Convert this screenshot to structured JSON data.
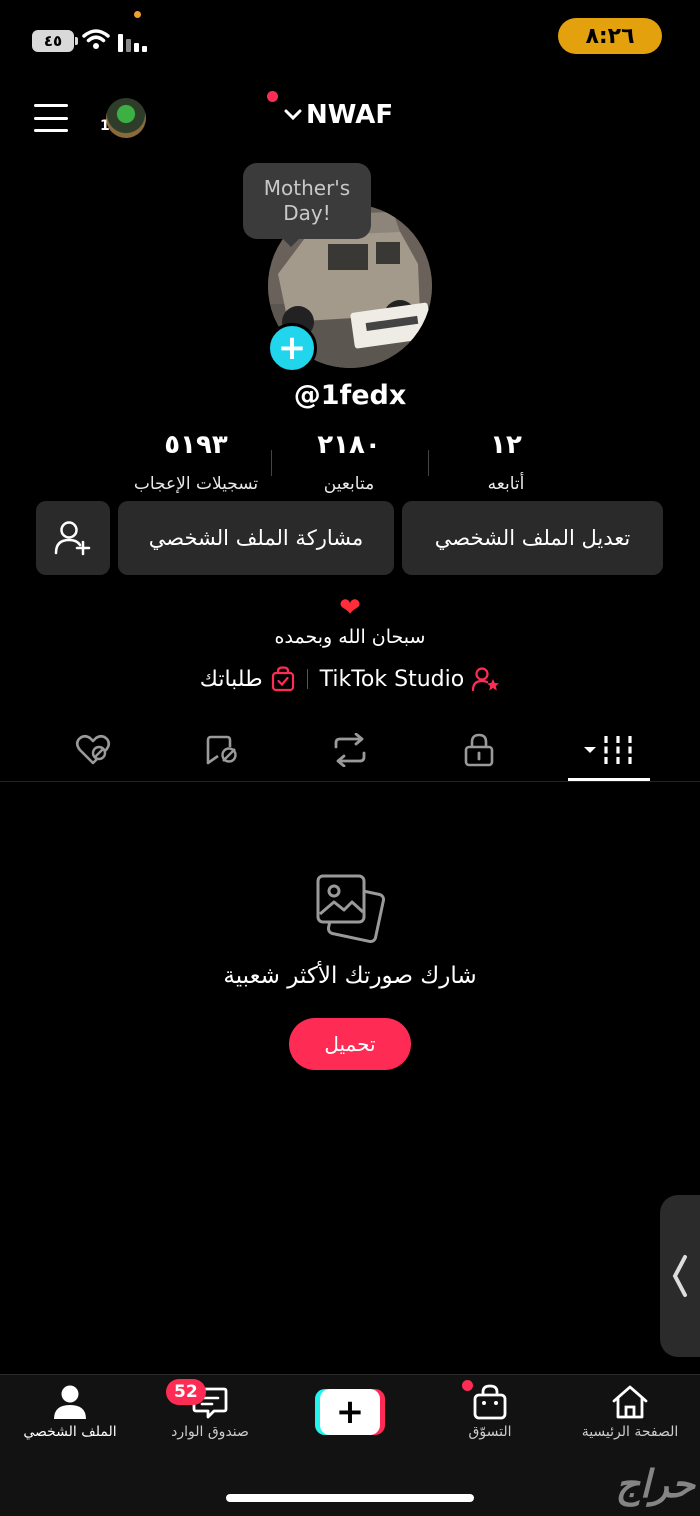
{
  "status_bar": {
    "time": "٨:٢٦",
    "battery": "٤٥"
  },
  "header": {
    "username": "NWAF",
    "story_count": "1"
  },
  "profile": {
    "tooltip": "Mother's Day!",
    "handle": "@1fedx",
    "stats": [
      {
        "value": "٥١٩٣",
        "label": "تسجيلات الإعجاب"
      },
      {
        "value": "٢١٨٠",
        "label": "متابعين"
      },
      {
        "value": "١٢",
        "label": "أتابعه"
      }
    ],
    "buttons": {
      "edit": "تعديل الملف الشخصي",
      "share": "مشاركة الملف الشخصي"
    },
    "bio": "سبحان الله وبحمده",
    "links": {
      "studio": "TikTok Studio",
      "orders": "طلباتك"
    }
  },
  "tabs": [
    "videos-tab",
    "private-tab",
    "reposts-tab",
    "favorites-tab",
    "liked-tab"
  ],
  "empty_state": {
    "text": "شارك صورتك الأكثر شعبية",
    "button": "تحميل"
  },
  "bottom_nav": {
    "profile": "الملف الشخصي",
    "inbox": "صندوق الوارد",
    "inbox_badge": "52",
    "shop": "التسوّق",
    "home": "الصفحة الرئيسية"
  },
  "watermark": "حراج",
  "colors": {
    "accent": "#fe2c55",
    "cyan": "#20d5ec",
    "time_pill": "#e3a10e"
  }
}
